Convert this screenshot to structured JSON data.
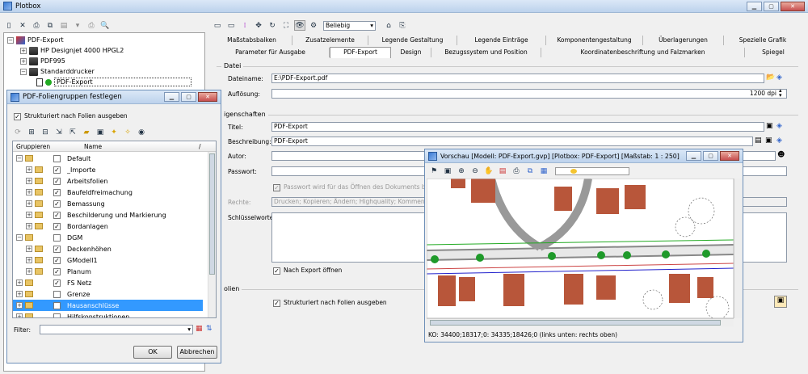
{
  "main": {
    "title": "Plotbox"
  },
  "tree": {
    "items": [
      {
        "label": "PDF-Export"
      },
      {
        "label": "HP Designjet 4000 HPGL2"
      },
      {
        "label": "PDF995"
      },
      {
        "label": "Standarddrucker"
      },
      {
        "label": "PDF-Export"
      }
    ]
  },
  "toolbar": {
    "scale": "Beliebig"
  },
  "tabs_row1": [
    "Maßstabsbalken",
    "Zusatzelemente",
    "Legende Gestaltung",
    "Legende Einträge",
    "Komponentengestaltung",
    "Überlagerungen",
    "Spezielle Grafik"
  ],
  "tabs_row2": [
    "Parameter für Ausgabe",
    "PDF-Export",
    "Design",
    "Bezugssystem und Position",
    "Koordinatenbeschriftung und Falzmarken",
    "Spiegel"
  ],
  "datei": {
    "group": "Datei",
    "dateiname_label": "Dateiname:",
    "dateiname_value": "E:\\PDF-Export.pdf",
    "aufloesung_label": "Auflösung:",
    "aufloesung_value": "1200 dpi"
  },
  "eigen": {
    "group": "igenschaften",
    "titel_label": "Titel:",
    "titel_value": "PDF-Export",
    "beschreibung_label": "Beschreibung:",
    "beschreibung_value": "PDF-Export",
    "autor_label": "Autor:",
    "passwort_label": "Passwort:",
    "pw_check": "Passwort wird für das Öffnen des Dokuments benötigt",
    "rechte_label": "Rechte:",
    "rechte_value": "Drucken; Kopieren; Ändern; Highquality; Kommentieren",
    "schluessel_label": "Schlüsselworte:",
    "nach_export": "Nach Export öffnen"
  },
  "folien": {
    "group": "olien",
    "strukturiert": "Strukturiert nach Folien ausgeben"
  },
  "dialog": {
    "title": "PDF-Foliengruppen festlegen",
    "strukturiert": "Strukturiert nach Folien ausgeben",
    "col_gruppieren": "Gruppieren",
    "col_name": "Name",
    "col_sort": "/",
    "rows": [
      {
        "name": "Default",
        "checked": false
      },
      {
        "name": "_Importe",
        "checked": true
      },
      {
        "name": "Arbeitsfolien",
        "checked": true
      },
      {
        "name": "Baufeldfreimachung",
        "checked": true
      },
      {
        "name": "Bemassung",
        "checked": true
      },
      {
        "name": "Beschilderung und Markierung",
        "checked": true
      },
      {
        "name": "Bordanlagen",
        "checked": true
      },
      {
        "name": "DGM",
        "checked": false
      },
      {
        "name": "Deckenhöhen",
        "checked": true
      },
      {
        "name": "GModell1",
        "checked": true
      },
      {
        "name": "Planum",
        "checked": true
      },
      {
        "name": "FS Netz",
        "checked": true
      },
      {
        "name": "Grenze",
        "checked": false
      },
      {
        "name": "Hausanschlüsse",
        "checked": true
      },
      {
        "name": "Hilfskonstruktionen",
        "checked": false
      }
    ],
    "filter_label": "Filter:",
    "ok": "OK",
    "abbrechen": "Abbrechen"
  },
  "preview": {
    "title": "Vorschau [Modell: PDF-Export.gvp] [Plotbox: PDF-Export] [Maßstab: 1 : 250]",
    "status": "KO: 34400;18317;0: 34335;18426;0 (links unten: rechts oben)"
  },
  "colors": {
    "accent": "#3399ff",
    "building": "#b8563a",
    "tree": "#1f9a2a",
    "titlebar": "#c9dbf0"
  },
  "icons": [
    "logo-icon",
    "new-icon",
    "delete-icon",
    "print-icon",
    "zoom-icon",
    "move-icon",
    "eye-icon",
    "folder-icon",
    "close-icon",
    "minimize-icon",
    "maximize-icon"
  ]
}
